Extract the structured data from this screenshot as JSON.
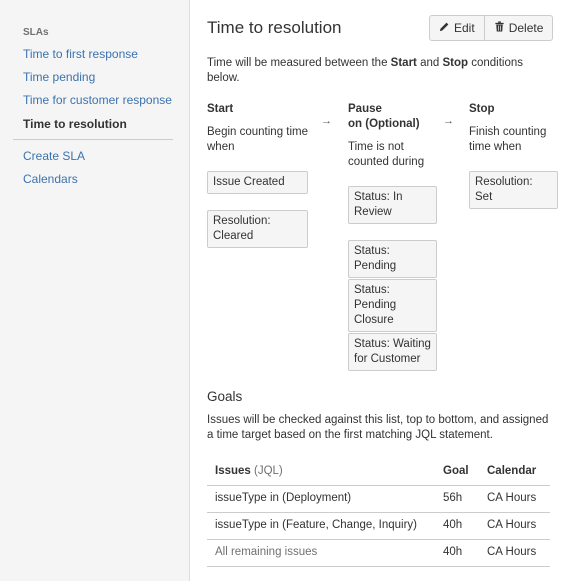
{
  "sidebar": {
    "heading": "SLAs",
    "items": [
      {
        "label": "Time to first response"
      },
      {
        "label": "Time pending"
      },
      {
        "label": "Time for customer response"
      },
      {
        "label": "Time to resolution"
      }
    ],
    "links": [
      {
        "label": "Create SLA"
      },
      {
        "label": "Calendars"
      }
    ]
  },
  "header": {
    "title": "Time to resolution",
    "edit_label": "Edit",
    "delete_label": "Delete"
  },
  "conditions": {
    "description_prefix": "Time will be measured between the ",
    "description_start": "Start",
    "description_mid": " and ",
    "description_stop": "Stop",
    "description_suffix": " conditions below.",
    "arrow": "→",
    "start": {
      "title": "Start",
      "subtitle": "Begin counting time when",
      "chips": [
        "Issue Created",
        "Resolution: Cleared"
      ]
    },
    "pause": {
      "title": "Pause",
      "title_on": "on",
      "title_optional": " (Optional)",
      "subtitle": "Time is not counted during",
      "chips": [
        "Status: In Review",
        "Status: Pending",
        "Status: Pending Closure",
        "Status: Waiting for Customer"
      ]
    },
    "stop": {
      "title": "Stop",
      "subtitle": "Finish counting time when",
      "chips": [
        "Resolution: Set"
      ]
    }
  },
  "goals": {
    "title": "Goals",
    "description": "Issues will be checked against this list, top to bottom, and assigned a time target based on the first matching JQL statement.",
    "headers": {
      "issues": "Issues",
      "jql": "(JQL)",
      "goal": "Goal",
      "calendar": "Calendar"
    },
    "rows": [
      {
        "issues": "issueType in (Deployment)",
        "goal": "56h",
        "calendar": "CA Hours"
      },
      {
        "issues": "issueType in (Feature, Change, Inquiry)",
        "goal": "40h",
        "calendar": "CA Hours"
      },
      {
        "issues": "All remaining issues",
        "goal": "40h",
        "calendar": "CA Hours"
      }
    ]
  }
}
